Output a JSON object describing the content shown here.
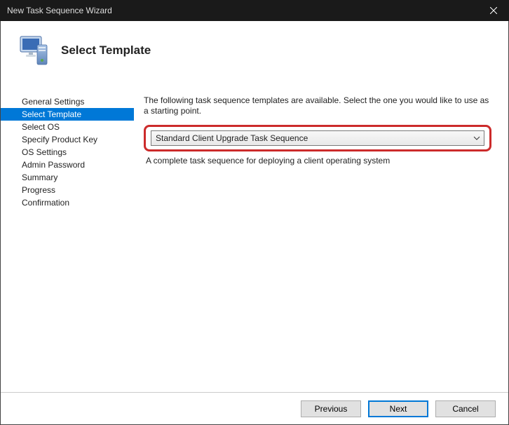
{
  "window": {
    "title": "New Task Sequence Wizard"
  },
  "header": {
    "title": "Select Template"
  },
  "sidebar": {
    "items": [
      {
        "label": "General Settings",
        "selected": false
      },
      {
        "label": "Select Template",
        "selected": true
      },
      {
        "label": "Select OS",
        "selected": false
      },
      {
        "label": "Specify Product Key",
        "selected": false
      },
      {
        "label": "OS Settings",
        "selected": false
      },
      {
        "label": "Admin Password",
        "selected": false
      },
      {
        "label": "Summary",
        "selected": false
      },
      {
        "label": "Progress",
        "selected": false
      },
      {
        "label": "Confirmation",
        "selected": false
      }
    ]
  },
  "main": {
    "instruction": "The following task sequence templates are available.  Select the one you would like to use as a starting point.",
    "template": {
      "selected": "Standard Client Upgrade Task Sequence",
      "description": "A complete task sequence for deploying a client operating system"
    }
  },
  "buttons": {
    "previous": "Previous",
    "next": "Next",
    "cancel": "Cancel"
  }
}
